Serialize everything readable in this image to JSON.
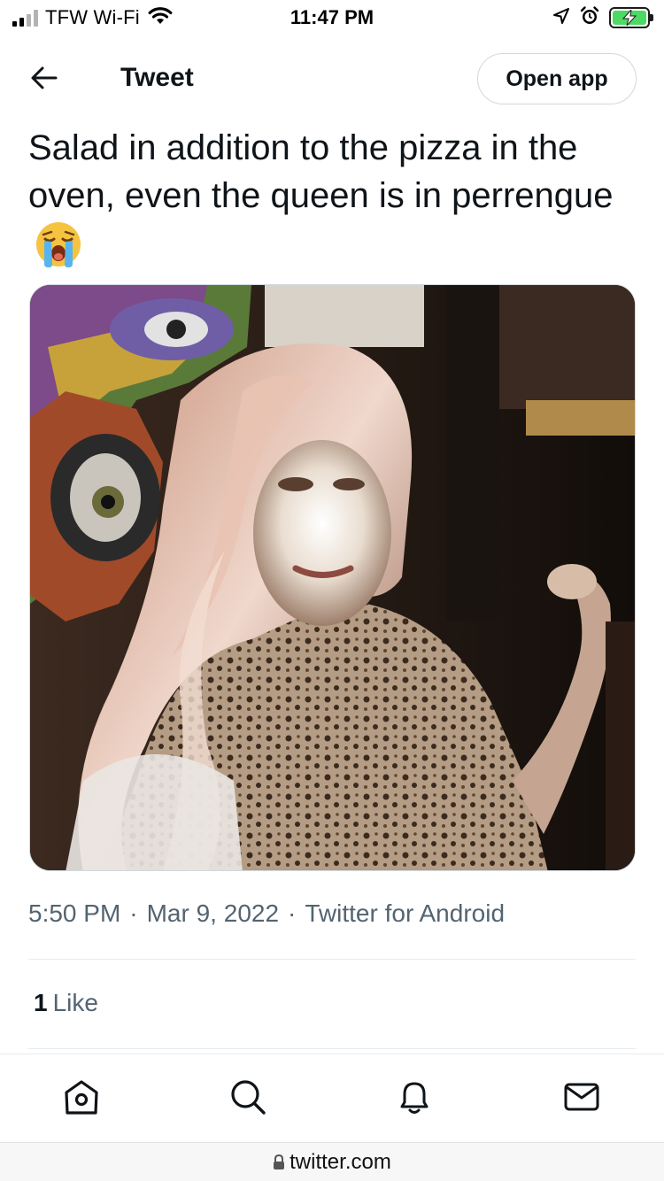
{
  "status_bar": {
    "carrier": "TFW Wi-Fi",
    "time": "11:47 PM",
    "signal_bars_active": 2,
    "signal_bars_total": 4,
    "battery_level": 1.0,
    "battery_color": "#4cd964",
    "icons": [
      "signal-icon",
      "wifi-icon",
      "location-arrow-icon",
      "alarm-icon",
      "battery-charging-icon"
    ]
  },
  "header": {
    "back_icon": "back-arrow-icon",
    "title": "Tweet",
    "open_app_label": "Open app"
  },
  "tweet": {
    "text": "Salad in addition to the pizza in the oven, even the queen is in perrengue",
    "emoji": "loudly-crying-face",
    "media": {
      "description_icon": "video-frame",
      "dominant_colors": [
        "#1e1713",
        "#6b4a3a",
        "#c9a58a"
      ]
    },
    "meta": {
      "time": "5:50 PM",
      "date": "Mar 9, 2022",
      "source": "Twitter for Android",
      "separator": "·"
    },
    "likes": {
      "count": "1",
      "label": "Like"
    }
  },
  "tab_bar": {
    "tabs": [
      {
        "name": "home",
        "icon": "home-icon"
      },
      {
        "name": "search",
        "icon": "search-icon"
      },
      {
        "name": "notifications",
        "icon": "bell-icon"
      },
      {
        "name": "messages",
        "icon": "mail-icon"
      }
    ],
    "icon_color": "#0f1419"
  },
  "browser": {
    "url": "twitter.com",
    "lock_icon": "lock-icon"
  }
}
